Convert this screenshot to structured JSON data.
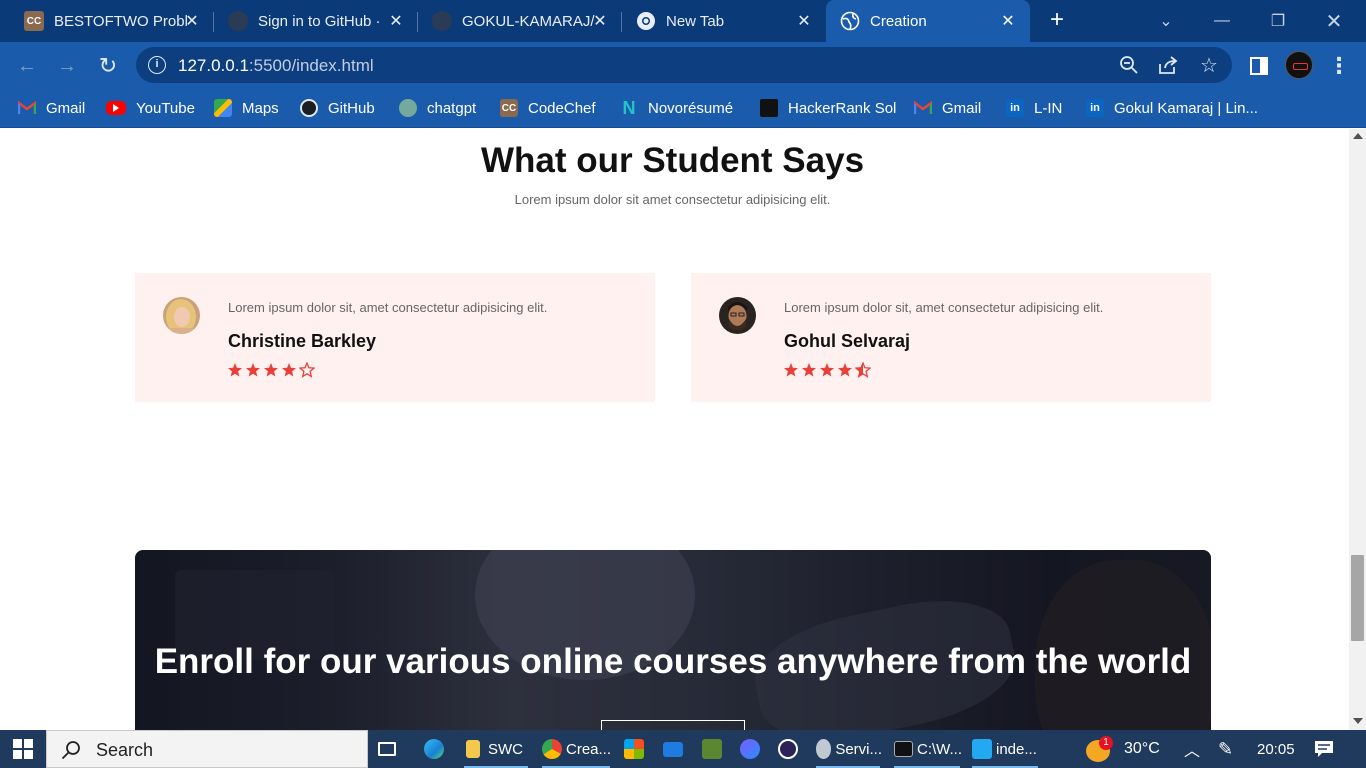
{
  "browser": {
    "tabs": [
      {
        "title": "BESTOFTWO Probl",
        "favicon": "codechef-icon",
        "active": false
      },
      {
        "title": "Sign in to GitHub ·",
        "favicon": "github-icon",
        "active": false
      },
      {
        "title": "GOKUL-KAMARAJ/",
        "favicon": "github-icon",
        "active": false
      },
      {
        "title": "New Tab",
        "favicon": "chrome-icon",
        "active": false
      },
      {
        "title": "Creation",
        "favicon": "globe-icon",
        "active": true
      }
    ],
    "url_host": "127.0.0.1",
    "url_rest": ":5500/index.html",
    "bookmarks": [
      {
        "label": "Gmail",
        "icon": "gmail-icon"
      },
      {
        "label": "YouTube",
        "icon": "youtube-icon"
      },
      {
        "label": "Maps",
        "icon": "maps-icon"
      },
      {
        "label": "GitHub",
        "icon": "github-icon"
      },
      {
        "label": "chatgpt",
        "icon": "chatgpt-icon"
      },
      {
        "label": "CodeChef",
        "icon": "codechef-icon"
      },
      {
        "label": "Novorésumé",
        "icon": "novoresume-icon"
      },
      {
        "label": "HackerRank Sol",
        "icon": "hackerrank-icon"
      },
      {
        "label": "Gmail",
        "icon": "gmail-icon"
      },
      {
        "label": "L-IN",
        "icon": "linkedin-icon"
      },
      {
        "label": "Gokul Kamaraj | Lin...",
        "icon": "linkedin-icon"
      }
    ],
    "colors": {
      "tabstrip": "#0b3a78",
      "toolbar": "#1a5cab"
    }
  },
  "page": {
    "testimonials": {
      "title": "What our Student Says",
      "subtitle": "Lorem ipsum dolor sit amet consectetur adipisicing elit.",
      "cards": [
        {
          "quote": "Lorem ipsum dolor sit, amet consectetur adipisicing elit.",
          "name": "Christine Barkley",
          "rating": 4
        },
        {
          "quote": "Lorem ipsum dolor sit, amet consectetur adipisicing elit.",
          "name": "Gohul Selvaraj",
          "rating": 4.5
        }
      ],
      "card_bg": "#fff1f0",
      "star_color": "#e8413c"
    },
    "banner": {
      "headline": "Enroll for our various online courses anywhere from the world"
    }
  },
  "taskbar": {
    "search_label": "Search",
    "items": [
      {
        "label": "",
        "icon": "task-view-icon"
      },
      {
        "label": "",
        "icon": "edge-icon"
      },
      {
        "label": "SWC",
        "icon": "folder-icon"
      },
      {
        "label": "Crea...",
        "icon": "chrome-icon"
      },
      {
        "label": "",
        "icon": "store-icon"
      },
      {
        "label": "",
        "icon": "mail-icon"
      },
      {
        "label": "",
        "icon": "minecraft-icon"
      },
      {
        "label": "",
        "icon": "clipchamp-icon"
      },
      {
        "label": "",
        "icon": "eclipse-icon"
      },
      {
        "label": "Servi...",
        "icon": "services-icon"
      },
      {
        "label": "C:\\W...",
        "icon": "cmd-icon"
      },
      {
        "label": "inde...",
        "icon": "vscode-icon"
      }
    ],
    "weather_badge": "1",
    "temperature": "30°C",
    "time": "20:05"
  }
}
